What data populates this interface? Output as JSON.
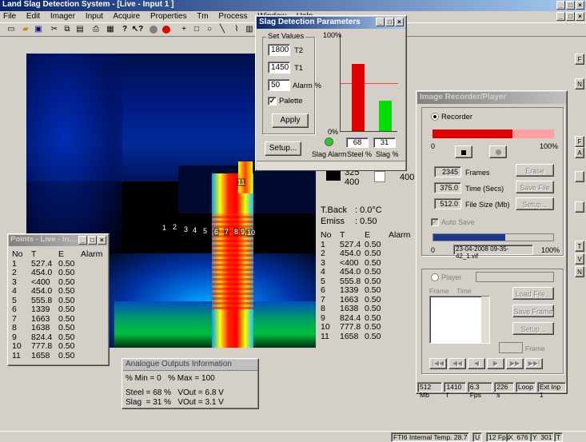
{
  "app": {
    "title": "Land Slag Detection System - [Live - Input 1 ]"
  },
  "menu": [
    "File",
    "Edit",
    "Imager",
    "Input",
    "Acquire",
    "Properties",
    "Tm",
    "Process",
    "Window",
    "Help"
  ],
  "thermal": {
    "markers": [
      "1",
      "2",
      "3",
      "4",
      "5",
      "6",
      "7",
      "8",
      "9",
      "10",
      "11"
    ],
    "t_back_label": "T.Back",
    "t_back_value": ": 0.0°C",
    "emiss_label": "Emiss",
    "emiss_value": ": 0.50",
    "scale_a": "325",
    "scale_b": "400",
    "scale_c": "400"
  },
  "main_table": {
    "headers": [
      "No",
      "T",
      "E",
      "Alarm"
    ],
    "rows": [
      [
        "1",
        "527.4",
        "0.50"
      ],
      [
        "2",
        "454.0",
        "0.50"
      ],
      [
        "3",
        "<400",
        "0.50"
      ],
      [
        "4",
        "454.0",
        "0.50"
      ],
      [
        "5",
        "555.8",
        "0.50"
      ],
      [
        "6",
        "1339",
        "0.50"
      ],
      [
        "7",
        "1663",
        "0.50"
      ],
      [
        "8",
        "1638",
        "0.50"
      ],
      [
        "9",
        "824.4",
        "0.50"
      ],
      [
        "10",
        "777.8",
        "0.50"
      ],
      [
        "11",
        "1658",
        "0.50"
      ]
    ]
  },
  "points_window": {
    "title": "Points - Live - In...",
    "headers": [
      "No",
      "T",
      "E",
      "Alarm"
    ],
    "rows": [
      [
        "1",
        "527.4",
        "0.50"
      ],
      [
        "2",
        "454.0",
        "0.50"
      ],
      [
        "3",
        "<400",
        "0.50"
      ],
      [
        "4",
        "454.0",
        "0.50"
      ],
      [
        "5",
        "555.8",
        "0.50"
      ],
      [
        "6",
        "1339",
        "0.50"
      ],
      [
        "7",
        "1663",
        "0.50"
      ],
      [
        "8",
        "1638",
        "0.50"
      ],
      [
        "9",
        "824.4",
        "0.50"
      ],
      [
        "10",
        "777.8",
        "0.50"
      ],
      [
        "11",
        "1658",
        "0.50"
      ]
    ]
  },
  "slag_dialog": {
    "title": "Slag Detection Parameters",
    "set_values_label": "Set Values",
    "t2_value": "1800",
    "t2_label": "T2",
    "t1_value": "1450",
    "t1_label": "T1",
    "alarm_value": "50",
    "alarm_label": "Alarm %",
    "palette_label": "Palette",
    "apply_label": "Apply",
    "setup_label": "Setup...",
    "pct100": "100%",
    "pct0": "0%",
    "slag_alarm_label": "Slag Alarm",
    "steel_value": "68",
    "steel_label": "Steel %",
    "slag_value": "31",
    "slag_label": "Slag %"
  },
  "recorder": {
    "title": "Image Recorder/Player",
    "recorder_label": "Recorder",
    "bar_min": "0",
    "bar_max": "100%",
    "frames_value": "2345",
    "frames_label": "Frames",
    "time_value": "375.0",
    "time_label": "Time (Secs)",
    "size_value": "512.0",
    "size_label": "File Size (Mb)",
    "erase_label": "Erase",
    "save_file_label": "Save File",
    "setup_label": "Setup...",
    "auto_save_label": "Auto Save",
    "progress_min": "0",
    "progress_max": "100%",
    "filename": "23-04-2008 09-35-42_1.vif",
    "player_label": "Player",
    "frame_col": "Frame",
    "time_col": "Time",
    "load_file_label": "Load File...",
    "save_frame_label": "Save Frame",
    "player_setup_label": "Setup...",
    "frame_label": "Frame",
    "status": [
      "512 Mb",
      "1410 f",
      "6.3 Fps",
      "226 s",
      "Loop",
      "Ext Inp 1"
    ]
  },
  "analogue": {
    "title": "Analogue Outputs Information",
    "line1": "% Min = 0   % Max = 100",
    "line2": "Steel = 68 %   VOut = 6.8 V",
    "line3": "Slag  = 31 %   VOut = 3.1 V"
  },
  "statusbar": {
    "internal_temp": "FTI6 Internal Temp. 28.7",
    "u": "U",
    "fps": "12 Fps",
    "x": "X  676",
    "y": "Y  301",
    "t": "T"
  },
  "side_buttons": [
    "F",
    "N",
    "F",
    "A",
    "T",
    "V",
    "N"
  ],
  "colors": {
    "steel": "#e00000",
    "slag": "#00e000",
    "alarm_line": "#ff4040",
    "rec_bar": "#e00000",
    "rec_bar_bg": "#ffa0a0",
    "progress": "#1a3a8c"
  },
  "levels": {
    "steel_pct": 68,
    "slag_pct": 31,
    "alarm_pct": 50,
    "rec_fill_pct": 66,
    "progress_fill_pct": 60
  }
}
